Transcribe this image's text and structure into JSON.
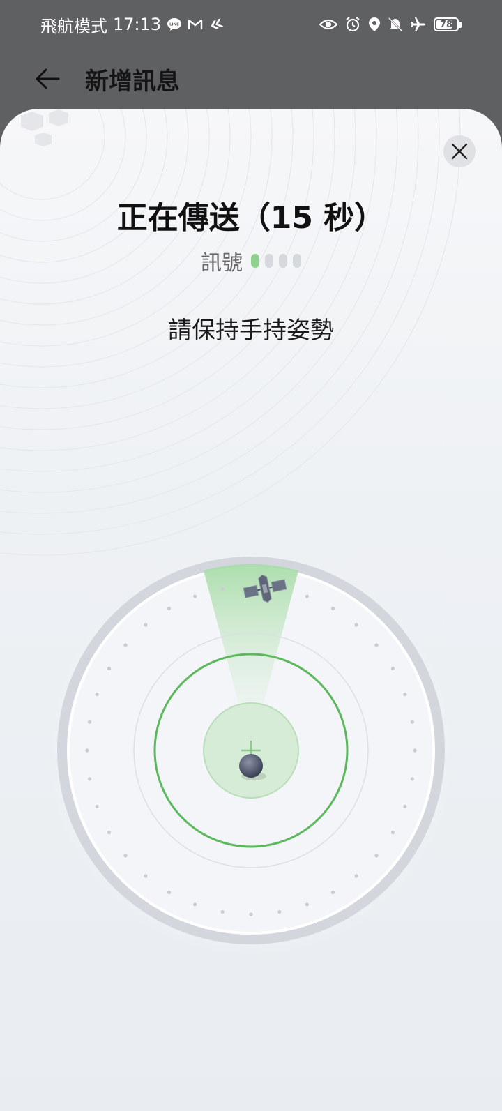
{
  "status_bar": {
    "mode_label": "飛航模式",
    "time": "17:13",
    "battery_level": "78",
    "battery_fraction": 0.78,
    "left_icons": [
      "line-icon",
      "gmail-icon",
      "app-icon"
    ],
    "right_icons": [
      "eye-icon",
      "alarm-icon",
      "location-icon",
      "bell-off-icon",
      "airplane-icon",
      "battery-icon"
    ]
  },
  "app_bar": {
    "title": "新增訊息",
    "back_icon": "back-arrow-icon"
  },
  "sheet": {
    "close_icon": "close-icon",
    "heading": "正在傳送（15 秒）",
    "signal_label": "訊號",
    "signal_strength": 1,
    "signal_max": 4,
    "hint": "請保持手持姿勢"
  },
  "radar": {
    "satellite_icon": "satellite-icon",
    "device_icon": "device-marker-icon",
    "accent": "#7bc47f",
    "ring_color": "#5cb85c"
  }
}
